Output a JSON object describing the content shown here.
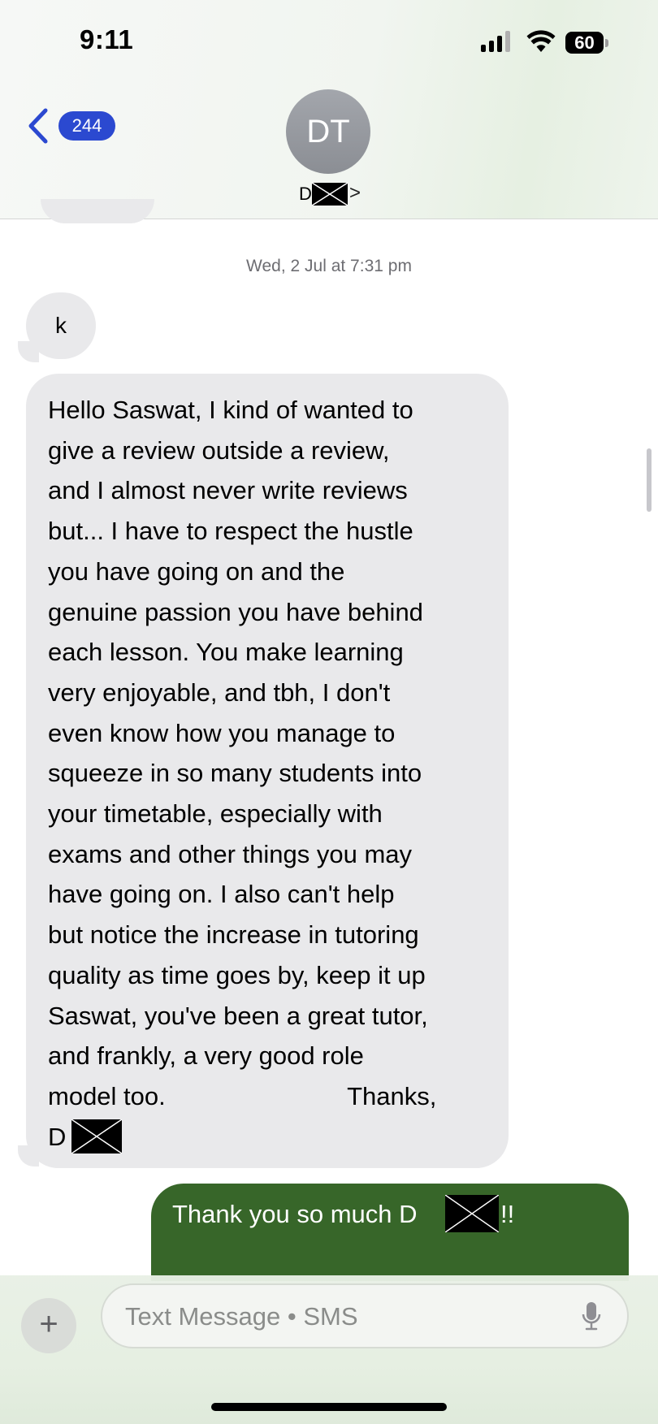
{
  "status_bar": {
    "time": "9:11",
    "battery_level": "60"
  },
  "nav": {
    "back_badge_count": "244"
  },
  "contact": {
    "avatar_initials": "DT",
    "name_initial": "D",
    "chevron": ">"
  },
  "conversation": {
    "timestamp": "Wed, 2 Jul at 7:31 pm",
    "messages": [
      {
        "direction": "incoming",
        "text": "k"
      },
      {
        "direction": "incoming",
        "text": "Hello Saswat, I kind of wanted to\ngive a review outside a review,\nand I almost never write reviews\nbut... I have to respect the hustle\nyou have going on and the\ngenuine passion you have behind\neach lesson. You make learning\nvery enjoyable, and tbh, I don't\neven know how you manage to\nsqueeze in so many students into\nyour timetable, especially with\nexams and other things you may\nhave going on. I also can't help\nbut notice the increase in tutoring\nquality as time goes by, keep it up\nSaswat, you've been a great tutor,\nand frankly, a very good role\nmodel too.                          Thanks,",
        "signature_initial": "D"
      },
      {
        "direction": "outgoing",
        "text_before_redaction": "Thank you so much D",
        "text_after_redaction": "!!"
      }
    ]
  },
  "composer": {
    "placeholder": "Text Message • SMS",
    "plus_label": "+"
  },
  "colors": {
    "incoming_bubble": "#e9e9eb",
    "outgoing_bubble": "#376629",
    "badge": "#2b49d0",
    "back_chevron": "#2b49d0"
  }
}
